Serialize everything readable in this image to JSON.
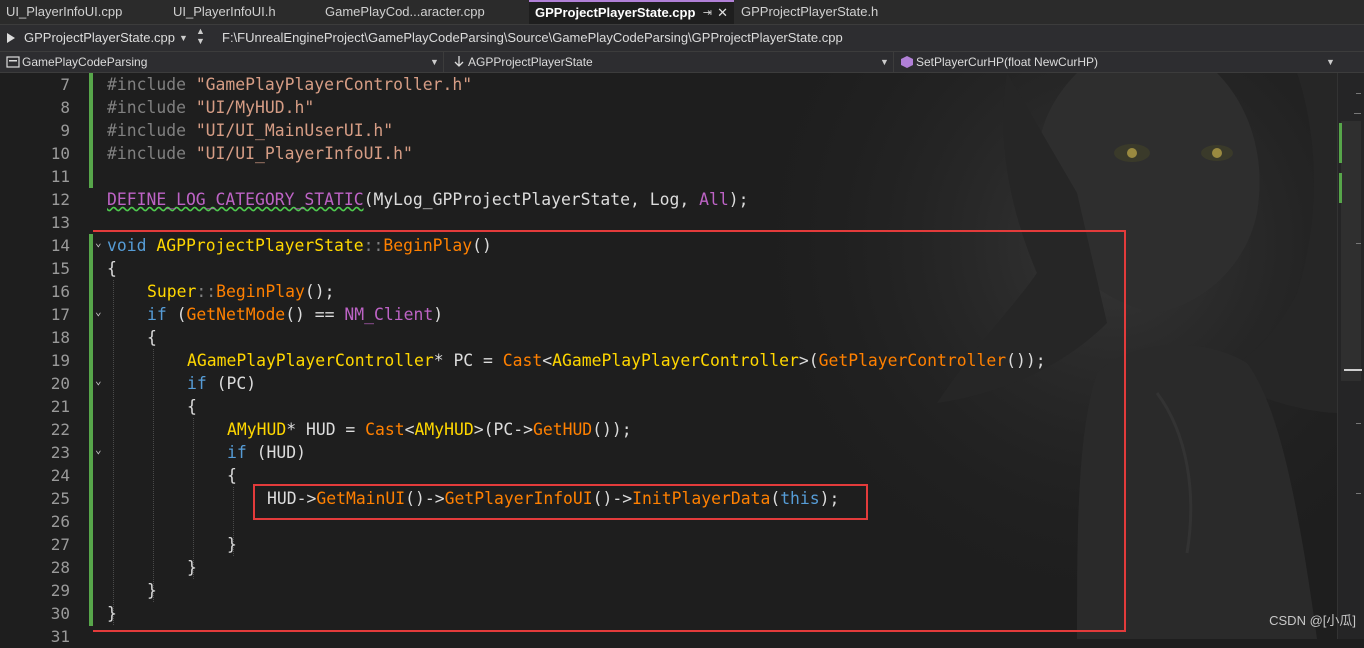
{
  "tabs": [
    {
      "label": "UI_PlayerInfoUI.cpp"
    },
    {
      "label": "UI_PlayerInfoUI.h"
    },
    {
      "label": "GamePlayCod...aracter.cpp"
    },
    {
      "label": "GPProjectPlayerState.cpp",
      "pin": "⇥",
      "close": "✕"
    },
    {
      "label": "GPProjectPlayerState.h"
    }
  ],
  "pathbar": {
    "file_dropdown": "GPProjectPlayerState.cpp",
    "path": "F:\\FUnrealEngineProject\\GamePlayCodeParsing\\Source\\GamePlayCodeParsing\\GPProjectPlayerState.cpp"
  },
  "navbar": {
    "project": "GamePlayCodeParsing",
    "class_scope": "AGPProjectPlayerState",
    "member": "SetPlayerCurHP(float NewCurHP)"
  },
  "line_numbers": [
    "7",
    "8",
    "9",
    "10",
    "11",
    "12",
    "13",
    "14",
    "15",
    "16",
    "17",
    "18",
    "19",
    "20",
    "21",
    "22",
    "23",
    "24",
    "25",
    "26",
    "27",
    "28",
    "29",
    "30",
    "31"
  ],
  "code": {
    "l7": [
      "#include ",
      "\"GamePlayPlayerController.h\""
    ],
    "l8": [
      "#include ",
      "\"UI/MyHUD.h\""
    ],
    "l9": [
      "#include ",
      "\"UI/UI_MainUserUI.h\""
    ],
    "l10": [
      "#include ",
      "\"UI/UI_PlayerInfoUI.h\""
    ],
    "l12": [
      "DEFINE_LOG_CATEGORY_STATIC",
      "(MyLog_GPProjectPlayerState, Log, ",
      "All",
      ");"
    ],
    "l14": [
      "void",
      " ",
      "AGPProjectPlayerState",
      "::",
      "BeginPlay",
      "()"
    ],
    "l15": [
      "{"
    ],
    "l16": [
      "Super",
      "::",
      "BeginPlay",
      "();"
    ],
    "l17": [
      "if",
      " (",
      "GetNetMode",
      "() == ",
      "NM_Client",
      ")"
    ],
    "l18": [
      "{"
    ],
    "l19": [
      "AGamePlayPlayerController",
      "* PC = ",
      "Cast",
      "<",
      "AGamePlayPlayerController",
      ">(",
      "GetPlayerController",
      "());"
    ],
    "l20": [
      "if",
      " (PC)"
    ],
    "l21": [
      "{"
    ],
    "l22": [
      "AMyHUD",
      "* HUD = ",
      "Cast",
      "<",
      "AMyHUD",
      ">(PC->",
      "GetHUD",
      "());"
    ],
    "l23": [
      "if",
      " (HUD)"
    ],
    "l24": [
      "{"
    ],
    "l25": [
      "HUD->",
      "GetMainUI",
      "()->",
      "GetPlayerInfoUI",
      "()->",
      "InitPlayerData",
      "(",
      "this",
      ");"
    ],
    "l27": [
      "}"
    ],
    "l28": [
      "}"
    ],
    "l29": [
      "}"
    ],
    "l30": [
      "}"
    ]
  },
  "fold_glyph": "⌄",
  "colors": {
    "keyword": "#569cd6",
    "function": "#ff8000",
    "type": "#ffd700",
    "string": "#d69d85",
    "macro": "#bd63c5",
    "highlight_box": "#e33b3b",
    "change_bar": "#57a64a"
  },
  "icons": [
    "dropdown-caret-icon",
    "fold-chevron-icon",
    "file-icon",
    "scope-icon",
    "pin-icon",
    "close-icon"
  ],
  "watermark": "CSDN @[小瓜]"
}
